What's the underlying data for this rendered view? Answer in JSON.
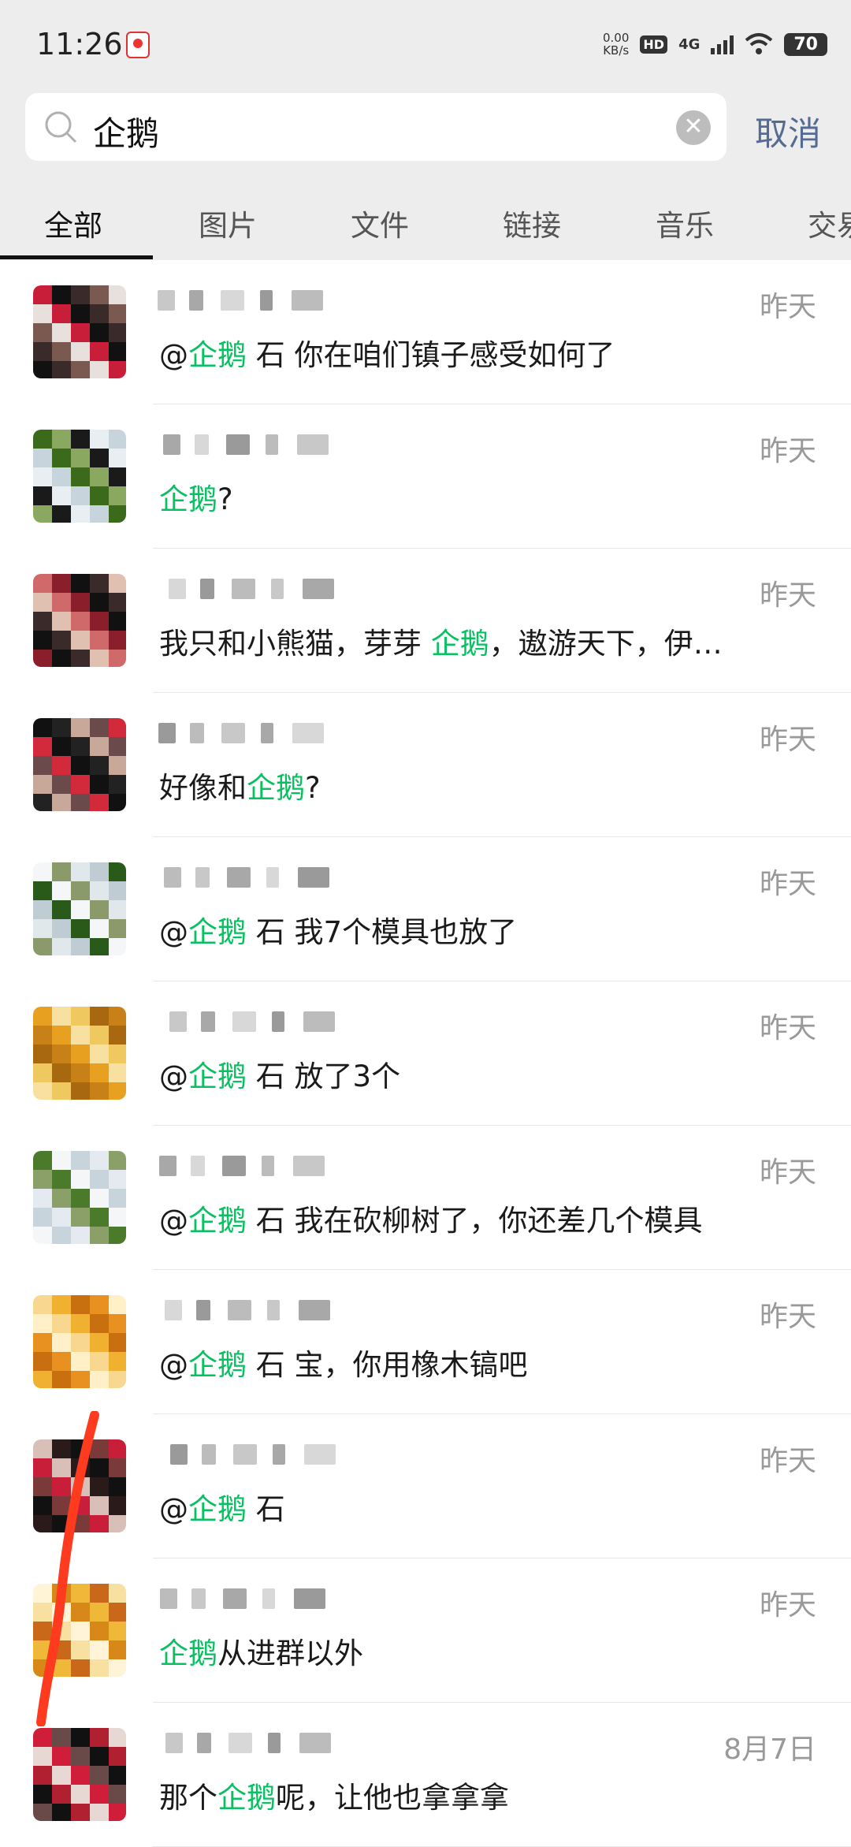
{
  "status_bar": {
    "time": "11:26",
    "net_speed_value": "0.00",
    "net_speed_unit": "KB/s",
    "hd": "HD",
    "network": "4G",
    "battery": "70"
  },
  "search": {
    "query": "企鹅",
    "cancel_label": "取消"
  },
  "tabs": [
    {
      "label": "全部",
      "active": true
    },
    {
      "label": "图片"
    },
    {
      "label": "文件"
    },
    {
      "label": "链接"
    },
    {
      "label": "音乐"
    },
    {
      "label": "交易"
    }
  ],
  "results": [
    {
      "time": "昨天",
      "pre": "@",
      "hl": "企鹅",
      "post": " 石 你在咱们镇子感受如何了"
    },
    {
      "time": "昨天",
      "pre": "",
      "hl": "企鹅",
      "post": "?"
    },
    {
      "time": "昨天",
      "pre": "我只和小熊猫，芽芽 ",
      "hl": "企鹅",
      "post": "，遨游天下，伊…"
    },
    {
      "time": "昨天",
      "pre": "好像和",
      "hl": "企鹅",
      "post": "?"
    },
    {
      "time": "昨天",
      "pre": "@",
      "hl": "企鹅",
      "post": " 石 我7个模具也放了"
    },
    {
      "time": "昨天",
      "pre": "@",
      "hl": "企鹅",
      "post": " 石 放了3个"
    },
    {
      "time": "昨天",
      "pre": "@",
      "hl": "企鹅",
      "post": " 石 我在砍柳树了，你还差几个模具"
    },
    {
      "time": "昨天",
      "pre": "@",
      "hl": "企鹅",
      "post": " 石 宝，你用橡木镐吧"
    },
    {
      "time": "昨天",
      "pre": "@",
      "hl": "企鹅",
      "post": " 石"
    },
    {
      "time": "昨天",
      "pre": "",
      "hl": "企鹅",
      "post": "从进群以外"
    },
    {
      "time": "8月7日",
      "pre": "那个",
      "hl": "企鹅",
      "post": "呢，让他也拿拿拿"
    }
  ],
  "colors": {
    "highlight": "#07c160",
    "cancel": "#566b94",
    "background_header": "#ededed"
  }
}
